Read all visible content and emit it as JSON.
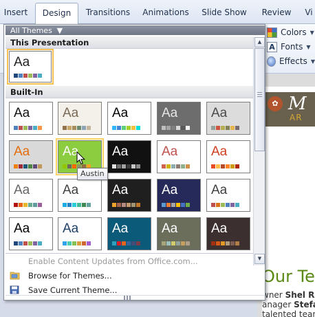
{
  "ribbon": {
    "tabs": [
      {
        "label": "Insert",
        "active": false
      },
      {
        "label": "Design",
        "active": true
      },
      {
        "label": "Transitions",
        "active": false
      },
      {
        "label": "Animations",
        "active": false
      },
      {
        "label": "Slide Show",
        "active": false
      },
      {
        "label": "Review",
        "active": false
      },
      {
        "label": "Vi",
        "active": false
      }
    ],
    "theme_commands": {
      "colors": "Colors",
      "fonts": "Fonts",
      "effects": "Effects"
    }
  },
  "gallery": {
    "filter_label": "All Themes",
    "this_presentation_title": "This Presentation",
    "built_in_title": "Built-In",
    "tooltip": "Austin",
    "current_theme": {
      "aa": "Aa",
      "bg": "#ffffff",
      "text": "#1a1a1a",
      "swatches": [
        "#1f497d",
        "#4f81bd",
        "#c0504d",
        "#9bbb59",
        "#8064a2",
        "#4bacc6"
      ]
    },
    "themes": [
      {
        "aa": "Aa",
        "bg": "#ffffff",
        "text": "#111111",
        "swatches": [
          "#4f81bd",
          "#c0504d",
          "#9bbb59",
          "#8064a2",
          "#4bacc6",
          "#f79646"
        ]
      },
      {
        "aa": "Aa",
        "bg": "#f4f1ea",
        "text": "#7a6a55",
        "swatches": [
          "#94734d",
          "#c9a66b",
          "#a88b5c",
          "#6c8b6e",
          "#8ba3b5",
          "#c6b59a"
        ]
      },
      {
        "aa": "Aa",
        "bg": "#ffffff",
        "text": "#000000",
        "swatches": [
          "#31b6fd",
          "#4584d3",
          "#5bd078",
          "#a5d028",
          "#f5c040",
          "#05e0db"
        ]
      },
      {
        "aa": "Aa",
        "bg": "#6d6d6d",
        "text": "#e6e6e6",
        "swatches": [
          "#bfbfbf",
          "#a5a5a5",
          "#7f7f7f",
          "#d9d9d9",
          "#595959",
          "#f2f2f2"
        ]
      },
      {
        "aa": "Aa",
        "bg": "#dcdcdc",
        "text": "#4a4a4a",
        "swatches": [
          "#93a299",
          "#cf543f",
          "#b5ae53",
          "#848058",
          "#e8b54d",
          "#786c71"
        ]
      },
      {
        "aa": "Aa",
        "bg": "#d9d9d9",
        "text": "#e46c0a",
        "swatches": [
          "#f07f09",
          "#9f2936",
          "#1b587c",
          "#4e8542",
          "#604878",
          "#c19859"
        ]
      },
      {
        "aa": "Aa",
        "bg": "#8ccc3f",
        "text": "#ffffff",
        "swatches": [
          "#94c600",
          "#71685a",
          "#ff6700",
          "#909465",
          "#956b43",
          "#fea022"
        ]
      },
      {
        "aa": "Aa",
        "bg": "#111111",
        "text": "#ffffff",
        "swatches": [
          "#e0e0e0",
          "#6f6f6f",
          "#a3a3a3",
          "#3d3d3d",
          "#c7c7c7",
          "#8a8a8a"
        ]
      },
      {
        "aa": "Aa",
        "bg": "#ffffff",
        "text": "#c0504d",
        "swatches": [
          "#d16349",
          "#ccb400",
          "#8cadae",
          "#8c7b70",
          "#8fb08c",
          "#d19049"
        ]
      },
      {
        "aa": "Aa",
        "bg": "#ffffff",
        "text": "#d0401f",
        "swatches": [
          "#e84c22",
          "#ffbd47",
          "#b64926",
          "#ff8427",
          "#cc9900",
          "#b22600"
        ]
      },
      {
        "aa": "Aa",
        "bg": "#ffffff",
        "text": "#666666",
        "swatches": [
          "#b01513",
          "#ea6312",
          "#e6b729",
          "#6aac90",
          "#5f9c9d",
          "#9e5e9b"
        ]
      },
      {
        "aa": "Aa",
        "bg": "#ffffff",
        "text": "#404040",
        "swatches": [
          "#1cade4",
          "#2683c6",
          "#27ced7",
          "#42ba97",
          "#3e8853",
          "#62a39f"
        ]
      },
      {
        "aa": "Aa",
        "bg": "#1f1f1f",
        "text": "#ffffff",
        "swatches": [
          "#f0a22e",
          "#a5644e",
          "#b58b80",
          "#c3986d",
          "#a19574",
          "#c17529"
        ]
      },
      {
        "aa": "Aa",
        "bg": "#262a5a",
        "text": "#ffffff",
        "swatches": [
          "#5b9bd5",
          "#ed7d31",
          "#a5a5a5",
          "#ffc000",
          "#4472c4",
          "#70ad47"
        ]
      },
      {
        "aa": "Aa",
        "bg": "#ffffff",
        "text": "#404040",
        "swatches": [
          "#c0504d",
          "#d8751a",
          "#9bbb59",
          "#4f81bd",
          "#8064a2",
          "#4bacc6"
        ]
      },
      {
        "aa": "Aa",
        "bg": "#ffffff",
        "text": "#000000",
        "swatches": [
          "#1f497d",
          "#4f81bd",
          "#c0504d",
          "#9bbb59",
          "#8064a2",
          "#4bacc6"
        ]
      },
      {
        "aa": "Aa",
        "bg": "#ffffff",
        "text": "#1f3f66",
        "swatches": [
          "#2fa3ee",
          "#4bcaad",
          "#86c157",
          "#d99c3f",
          "#ce6633",
          "#a35dd1"
        ]
      },
      {
        "aa": "Aa",
        "bg": "#0b5a7a",
        "text": "#ffffff",
        "swatches": [
          "#2da2bf",
          "#da1f28",
          "#eb641b",
          "#39639d",
          "#474b78",
          "#7d3c4a"
        ]
      },
      {
        "aa": "Aa",
        "bg": "#6a6e5a",
        "text": "#ffffff",
        "swatches": [
          "#a9a57c",
          "#9cbebd",
          "#d2cb6c",
          "#95a39d",
          "#c89f5d",
          "#b1a089"
        ]
      },
      {
        "aa": "Aa",
        "bg": "#3b2f2f",
        "text": "#ffffff",
        "swatches": [
          "#a5300f",
          "#d55816",
          "#e19825",
          "#b19c7d",
          "#7f5f52",
          "#b27d49"
        ]
      }
    ],
    "menu": {
      "enable_updates": "Enable Content Updates from Office.com...",
      "browse": "Browse for Themes...",
      "save": "Save Current Theme..."
    }
  },
  "slide": {
    "head_letter": "M",
    "head_sub": "AR",
    "title": "Our Tea",
    "line1_prefix": "wner ",
    "line1_bold": "Shel Rh",
    "line2_prefix": "anager ",
    "line2_bold": "Stefa",
    "line3": "talented tean"
  }
}
